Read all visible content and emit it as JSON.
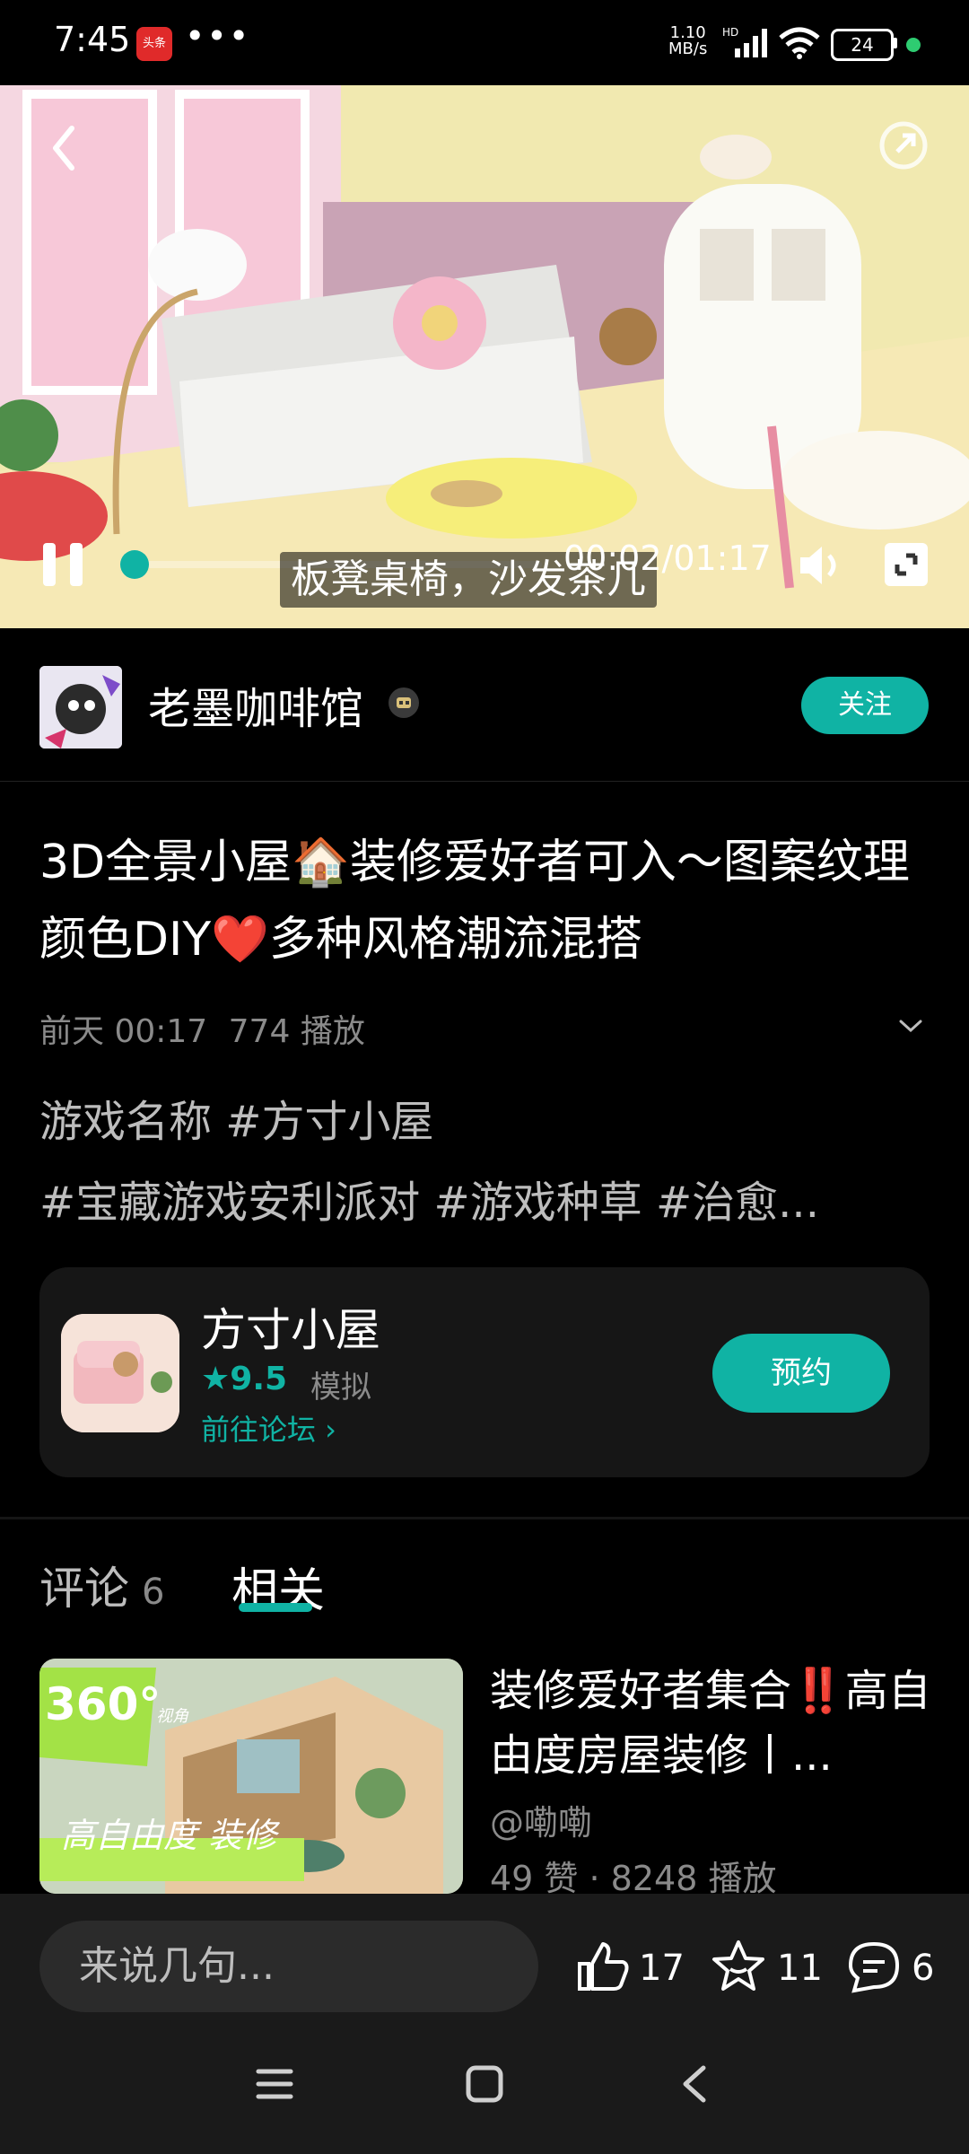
{
  "status_bar": {
    "time": "7:45",
    "app_badge": "头条",
    "more": "•••",
    "net_speed_value": "1.10",
    "net_speed_unit": "MB/s",
    "hd": "HD",
    "battery": "24"
  },
  "video": {
    "subtitle": "板凳桌椅，沙发茶几",
    "time_display": "00:02/01:17",
    "progress": 0.026
  },
  "author": {
    "name": "老墨咖啡馆",
    "follow_label": "关注"
  },
  "post": {
    "title": "3D全景小屋🏠装修爱好者可入～图案纹理颜色DIY❤️多种风格潮流混搭",
    "time": "前天 00:17",
    "plays": "774 播放",
    "tags_line1": "游戏名称 #方寸小屋",
    "tags_line2": "#宝藏游戏安利派对 #游戏种草 #治愈..."
  },
  "game_card": {
    "name": "方寸小屋",
    "rating": "9.5",
    "category": "模拟",
    "forum_link": "前往论坛 ›",
    "action_label": "预约"
  },
  "tabs": {
    "comments_label": "评论",
    "comments_count": "6",
    "related_label": "相关"
  },
  "related": [
    {
      "title": "装修爱好者集合‼️高自由度房屋装修丨...",
      "author": "@嘞嘞",
      "stats": "49 赞 · 8248 播放",
      "thumb_badge": "360°",
      "thumb_badge_sub": "视角",
      "thumb_caption": "高自由度 装修"
    }
  ],
  "bottom_bar": {
    "input_placeholder": "来说几句...",
    "likes": "17",
    "favorites": "11",
    "comments": "6"
  },
  "colors": {
    "accent": "#10b3a4",
    "background": "#000000",
    "card": "#161616"
  }
}
